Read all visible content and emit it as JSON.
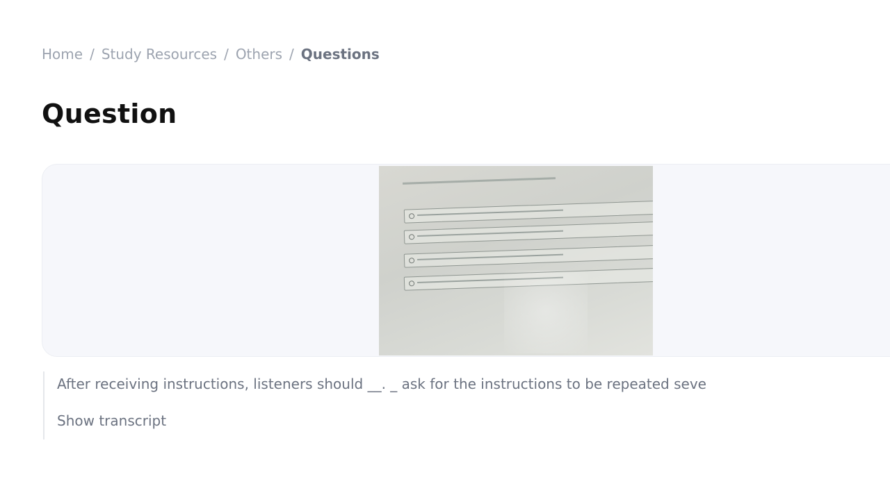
{
  "breadcrumb": {
    "items": [
      "Home",
      "Study Resources",
      "Others"
    ],
    "current": "Questions",
    "separator": "/"
  },
  "page": {
    "title": "Question"
  },
  "question": {
    "transcript_text": "After receiving instructions, listeners should __. _ ask for the instructions to be repeated seve",
    "show_transcript_label": "Show transcript"
  },
  "colors": {
    "breadcrumb_text": "#9ca3af",
    "breadcrumb_current": "#6b7280",
    "title": "#111111",
    "card_background": "#f6f7fb",
    "transcript_text": "#6b7280"
  }
}
